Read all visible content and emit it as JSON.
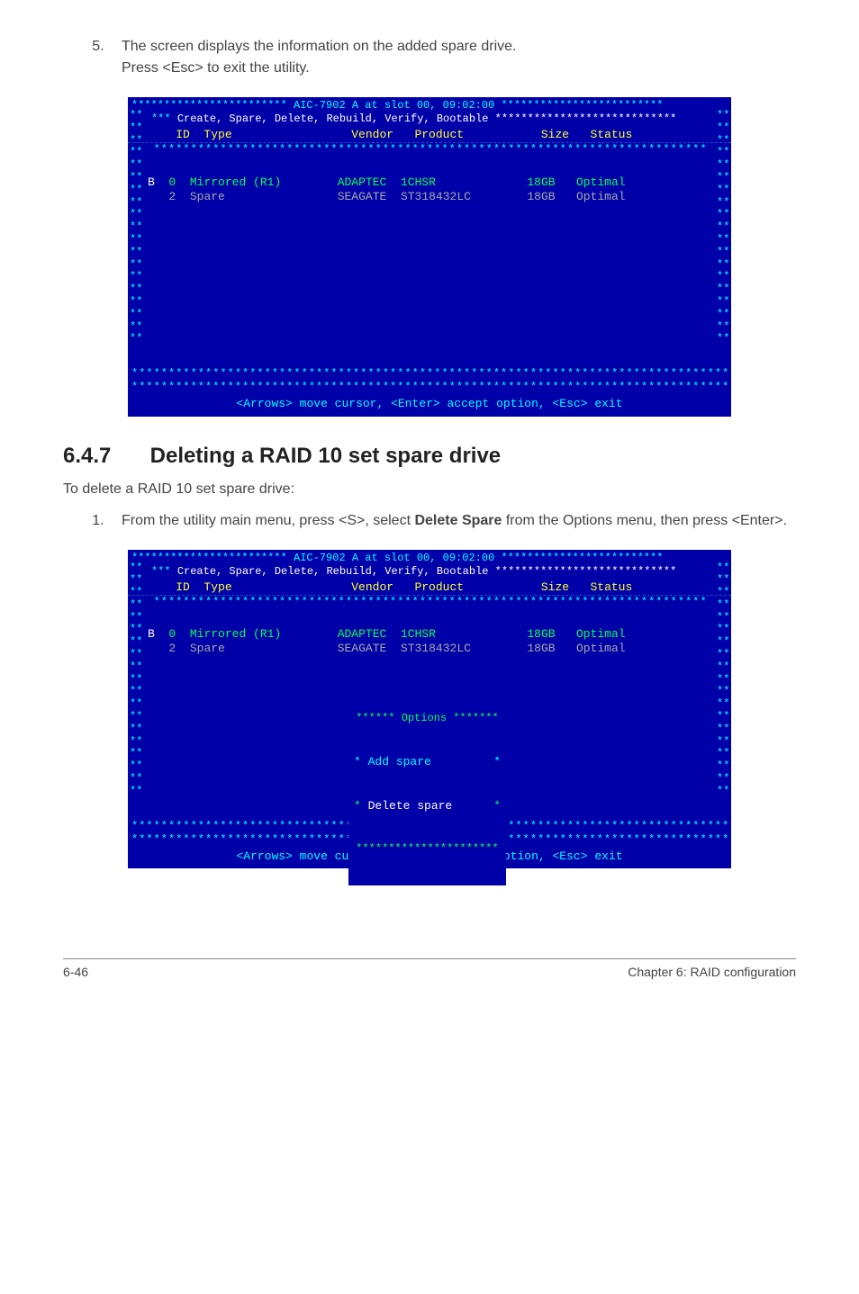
{
  "step5": {
    "num": "5.",
    "text_line1": "The screen displays the information on the added spare drive.",
    "text_line2": "Press <Esc> to exit the utility."
  },
  "screen1": {
    "title": "************************ AIC-7902 A at slot 00, 09:02:00 *************************",
    "menubar": "Create, Spare, Delete, Rebuild, Verify, Bootable ****************************",
    "header": "    ID  Type                 Vendor   Product           Size   Status",
    "rows": [
      {
        "b": "B",
        "id": "0",
        "type": "Mirrored (R1)",
        "vendor": "ADAPTEC",
        "product": "1CHSR",
        "size": "18GB",
        "status": "Optimal"
      },
      {
        "b": " ",
        "id": "2",
        "type": "Spare",
        "vendor": "SEAGATE",
        "product": "ST318432LC",
        "size": "18GB",
        "status": "Optimal"
      }
    ],
    "divider": "*************************************************************************************",
    "footerhint": "<Arrows> move cursor, <Enter> accept option, <Esc> exit"
  },
  "section": {
    "num": "6.4.7",
    "title": "Deleting a RAID 10 set spare drive"
  },
  "intro": "To delete a RAID 10 set spare drive:",
  "step1": {
    "num": "1.",
    "text": "From the utility main menu, press <S>, select ",
    "bold": "Delete Spare",
    "text2": " from the Options menu, then press <Enter>."
  },
  "screen2": {
    "title": "************************ AIC-7902 A at slot 00, 09:02:00 *************************",
    "menubar": "Create, Spare, Delete, Rebuild, Verify, Bootable ****************************",
    "header": "    ID  Type                 Vendor   Product           Size   Status",
    "rows": [
      {
        "b": "B",
        "id": "0",
        "type": "Mirrored (R1)",
        "vendor": "ADAPTEC",
        "product": "1CHSR",
        "size": "18GB",
        "status": "Optimal"
      },
      {
        "b": " ",
        "id": "2",
        "type": "Spare",
        "vendor": "SEAGATE",
        "product": "ST318432LC",
        "size": "18GB",
        "status": "Optimal"
      }
    ],
    "options": {
      "title": "****** Options *******",
      "add": "Add spare",
      "delete": "Delete spare",
      "bottom": "**********************"
    },
    "divider": "*************************************************************************************",
    "footerhint": "<Arrows> move cursor, <Enter> accept option, <Esc> exit"
  },
  "pagefooter": {
    "left": "6-46",
    "right": "Chapter 6: RAID configuration"
  }
}
